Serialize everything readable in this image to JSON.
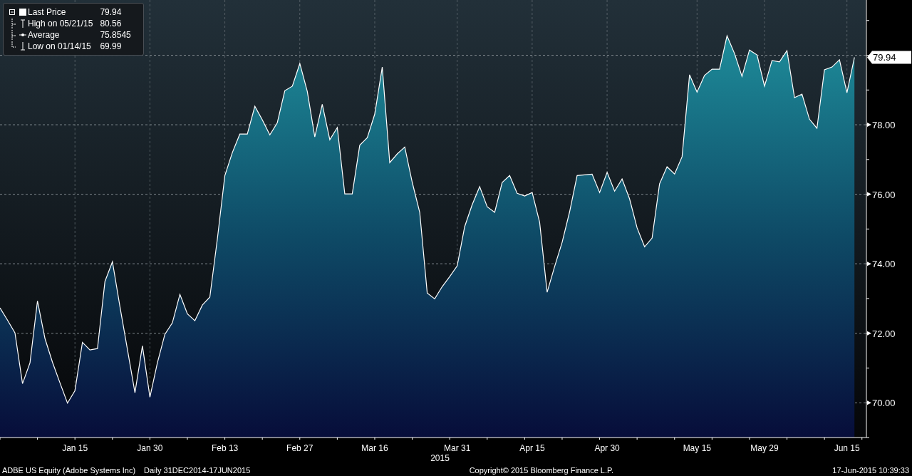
{
  "legend": {
    "items": [
      {
        "kind": "square",
        "value": "79.94"
      },
      {
        "kind": "high",
        "label": "High on 05/21/15",
        "value": "80.56"
      },
      {
        "kind": "average",
        "label": "Average",
        "value": "75.8545"
      },
      {
        "kind": "low",
        "label": "Low on 01/14/15",
        "value": "69.99"
      }
    ]
  },
  "chart": {
    "last_price_tag": "79.94",
    "chart_data": {
      "type": "area",
      "xlabel": "2015",
      "ylim": [
        69,
        81.59
      ],
      "yticks": [
        {
          "value": 70,
          "label": "70.00"
        },
        {
          "value": 72,
          "label": "72.00"
        },
        {
          "value": 74,
          "label": "74.00"
        },
        {
          "value": 76,
          "label": "76.00"
        },
        {
          "value": 78,
          "label": "78.00"
        }
      ],
      "grid": true,
      "categories": [
        null,
        null,
        null,
        null,
        null,
        null,
        null,
        null,
        null,
        null,
        "Jan 15",
        null,
        null,
        null,
        null,
        null,
        null,
        null,
        null,
        null,
        "Jan 30",
        null,
        null,
        null,
        null,
        null,
        null,
        null,
        null,
        null,
        "Feb 13",
        null,
        null,
        null,
        null,
        null,
        null,
        null,
        null,
        null,
        "Feb 27",
        null,
        null,
        null,
        null,
        null,
        null,
        null,
        null,
        null,
        "Mar 16",
        null,
        null,
        null,
        null,
        null,
        null,
        null,
        null,
        null,
        null,
        "Mar 31",
        null,
        null,
        null,
        null,
        null,
        null,
        null,
        null,
        null,
        "Apr 15",
        null,
        null,
        null,
        null,
        null,
        null,
        null,
        null,
        null,
        "Apr 30",
        null,
        null,
        null,
        null,
        null,
        null,
        null,
        null,
        null,
        null,
        null,
        "May 15",
        null,
        null,
        null,
        null,
        null,
        null,
        null,
        null,
        "May 29",
        null,
        null,
        null,
        null,
        null,
        null,
        null,
        null,
        null,
        null,
        "Jun 15",
        null
      ],
      "series": [
        {
          "name": "Last Price",
          "color": "#ffffff",
          "values": [
            72.73,
            72.38,
            72.01,
            70.55,
            71.15,
            72.93,
            71.85,
            71.17,
            70.57,
            69.99,
            70.35,
            71.74,
            71.52,
            71.56,
            73.49,
            74.06,
            72.77,
            71.54,
            70.29,
            71.64,
            70.16,
            71.15,
            71.97,
            72.3,
            73.12,
            72.56,
            72.36,
            72.81,
            73.04,
            74.72,
            76.54,
            77.2,
            77.73,
            77.73,
            78.53,
            78.14,
            77.71,
            78.06,
            78.98,
            79.11,
            79.76,
            78.96,
            77.65,
            78.59,
            77.57,
            77.92,
            76.01,
            76.01,
            77.41,
            77.63,
            78.31,
            79.66,
            76.91,
            77.16,
            77.36,
            76.34,
            75.48,
            73.16,
            72.99,
            73.34,
            73.63,
            73.94,
            75.07,
            75.7,
            76.22,
            75.64,
            75.48,
            76.34,
            76.54,
            76.03,
            75.95,
            76.05,
            75.19,
            73.18,
            73.92,
            74.62,
            75.5,
            76.54,
            76.56,
            76.58,
            76.05,
            76.63,
            76.09,
            76.44,
            75.87,
            75.03,
            74.49,
            74.74,
            76.3,
            76.79,
            76.58,
            77.08,
            79.44,
            78.94,
            79.42,
            79.6,
            79.6,
            80.56,
            80.05,
            79.39,
            80.15,
            80.01,
            79.11,
            79.85,
            79.81,
            80.13,
            78.78,
            78.88,
            78.16,
            77.9,
            79.58,
            79.66,
            79.87,
            78.92,
            79.94
          ]
        }
      ]
    }
  },
  "footer": {
    "security": "ADBE US Equity (Adobe Systems Inc)",
    "period": "Daily 31DEC2014-17JUN2015",
    "copyright": "Copyright© 2015 Bloomberg Finance L.P.",
    "timestamp": "17-Jun-2015 10:39:33"
  }
}
